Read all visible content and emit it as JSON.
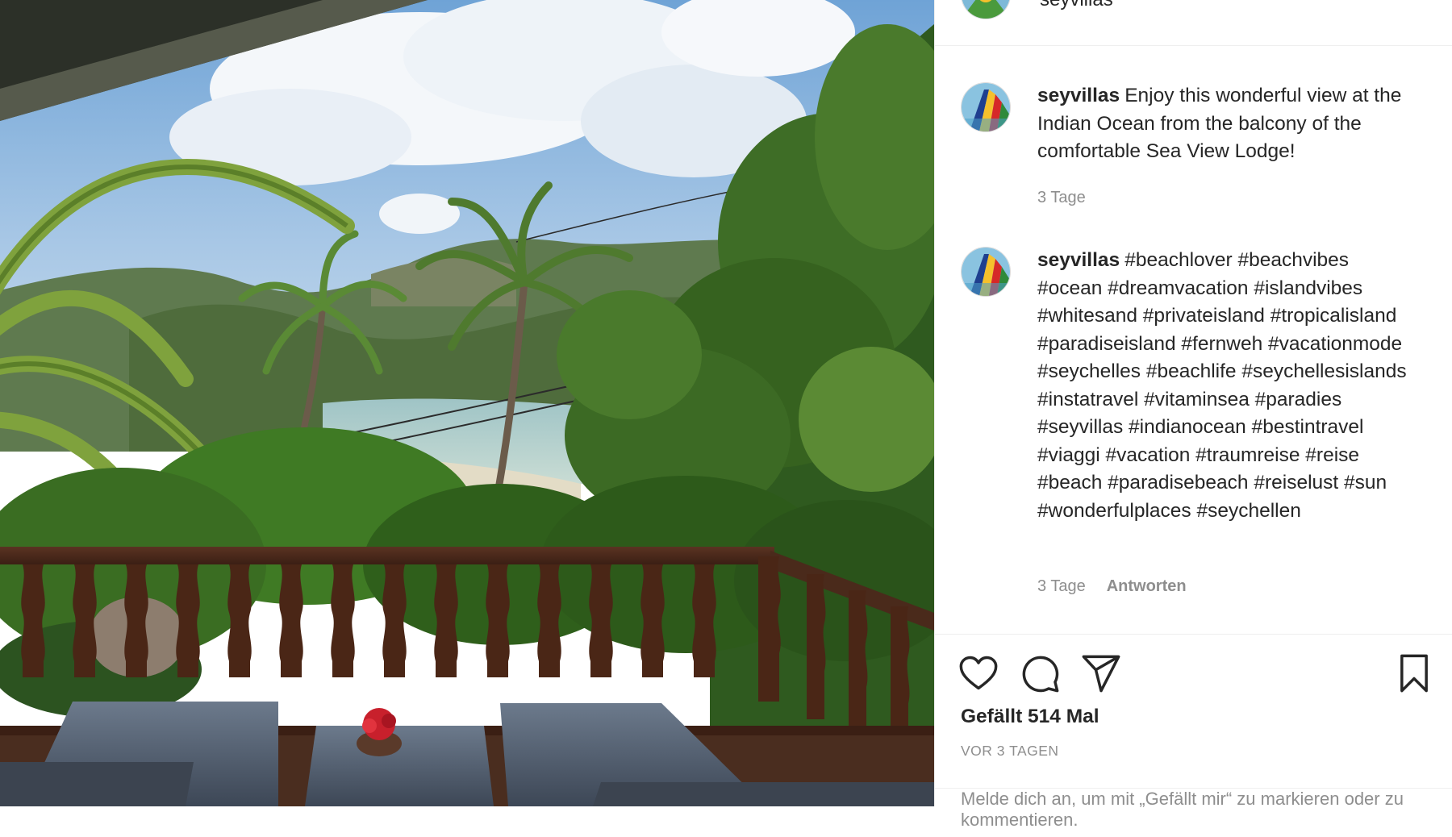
{
  "post": {
    "top_username": "seyvillas",
    "caption": {
      "username": "seyvillas",
      "text": "Enjoy this wonderful view at the Indian Ocean from the balcony of the comfortable Sea View Lodge!",
      "age": "3 Tage"
    },
    "comment": {
      "username": "seyvillas",
      "text": "#beachlover #beachvibes #ocean #dreamvacation #islandvibes #whitesand #privateisland #tropicalisland #paradiseisland #fernweh #vacationmode #seychelles #beachlife #seychellesislands #instatravel #vitaminsea #paradies #seyvillas #indianocean #bestintravel #viaggi #vacation #traumreise #reise #beach #paradisebeach #reiselust #sun #wonderfulplaces #seychellen",
      "age": "3 Tage",
      "reply_label": "Antworten"
    },
    "actions": {
      "like_icon": "heart-outline-icon",
      "comment_icon": "speech-bubble-icon",
      "share_icon": "paper-plane-icon",
      "save_icon": "bookmark-icon"
    },
    "likes_text": "Gefällt 514 Mal",
    "timestamp": "vor 3 Tagen",
    "add_comment_placeholder": "Melde dich an, um mit „Gefällt mir“ zu markieren oder zu kommentieren."
  },
  "colors": {
    "text": "#262626",
    "muted": "#8e8e8e",
    "divider": "#efefef"
  }
}
